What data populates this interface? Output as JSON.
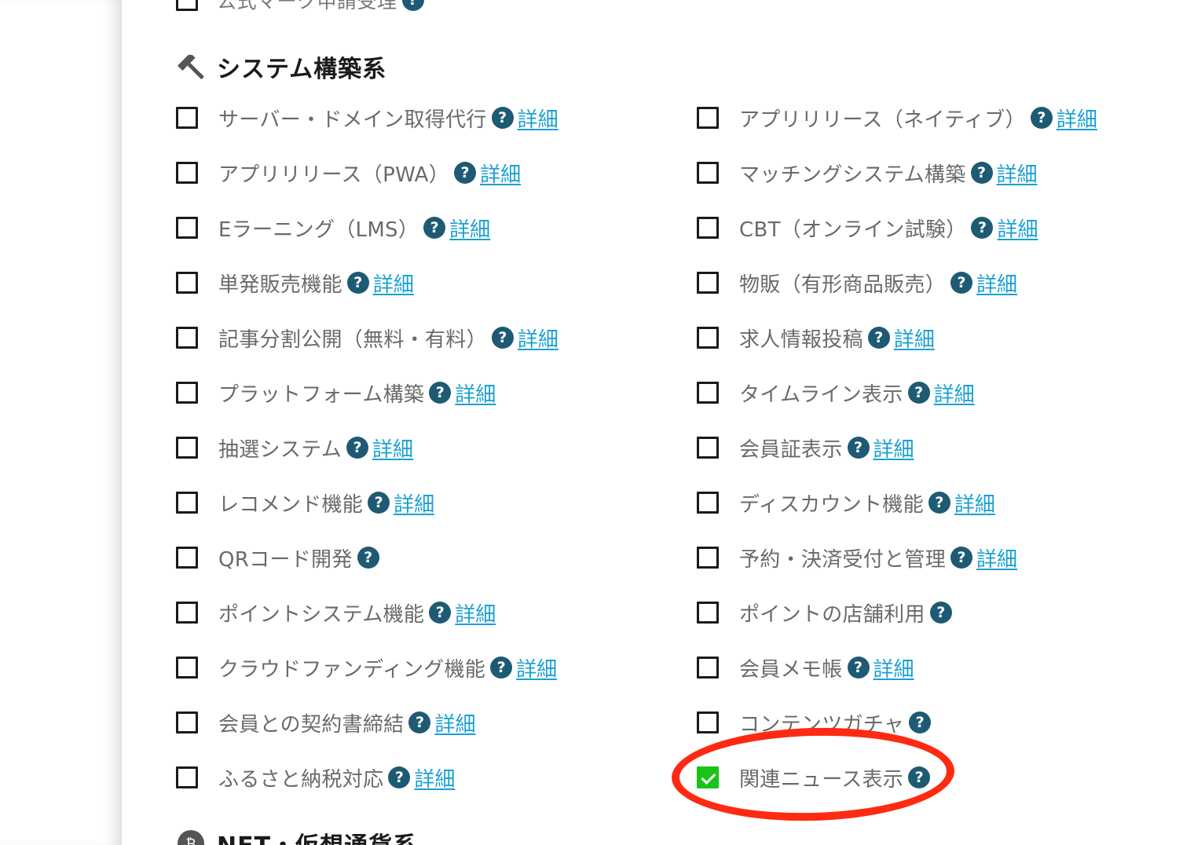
{
  "top_partial_item": {
    "label": "公式マーク申請受理"
  },
  "section_system": {
    "title": "システム構築系",
    "icon": "hammer-icon",
    "left_items": [
      {
        "label": "サーバー・ドメイン取得代行",
        "detail": "詳細",
        "checked": false
      },
      {
        "label": "アプリリリース（PWA）",
        "detail": "詳細",
        "checked": false
      },
      {
        "label": "Eラーニング（LMS）",
        "detail": "詳細",
        "checked": false
      },
      {
        "label": "単発販売機能",
        "detail": "詳細",
        "checked": false
      },
      {
        "label": "記事分割公開（無料・有料）",
        "detail": "詳細",
        "checked": false
      },
      {
        "label": "プラットフォーム構築",
        "detail": "詳細",
        "checked": false
      },
      {
        "label": "抽選システム",
        "detail": "詳細",
        "checked": false
      },
      {
        "label": "レコメンド機能",
        "detail": "詳細",
        "checked": false
      },
      {
        "label": "QRコード開発",
        "detail": "",
        "checked": false
      },
      {
        "label": "ポイントシステム機能",
        "detail": "詳細",
        "checked": false
      },
      {
        "label": "クラウドファンディング機能",
        "detail": "詳細",
        "checked": false
      },
      {
        "label": "会員との契約書締結",
        "detail": "詳細",
        "checked": false
      },
      {
        "label": "ふるさと納税対応",
        "detail": "詳細",
        "checked": false
      }
    ],
    "right_items": [
      {
        "label": "アプリリリース（ネイティブ）",
        "detail": "詳細",
        "checked": false
      },
      {
        "label": "マッチングシステム構築",
        "detail": "詳細",
        "checked": false
      },
      {
        "label": "CBT（オンライン試験）",
        "detail": "詳細",
        "checked": false
      },
      {
        "label": "物販（有形商品販売）",
        "detail": "詳細",
        "checked": false
      },
      {
        "label": "求人情報投稿",
        "detail": "詳細",
        "checked": false
      },
      {
        "label": "タイムライン表示",
        "detail": "詳細",
        "checked": false
      },
      {
        "label": "会員証表示",
        "detail": "詳細",
        "checked": false
      },
      {
        "label": "ディスカウント機能",
        "detail": "詳細",
        "checked": false
      },
      {
        "label": "予約・決済受付と管理",
        "detail": "詳細",
        "checked": false
      },
      {
        "label": "ポイントの店舗利用",
        "detail": "",
        "checked": false
      },
      {
        "label": "会員メモ帳",
        "detail": "詳細",
        "checked": false
      },
      {
        "label": "コンテンツガチャ",
        "detail": "",
        "checked": false
      },
      {
        "label": "関連ニュース表示",
        "detail": "",
        "checked": true
      }
    ]
  },
  "section_nft": {
    "title": "NFT・仮想通貨系",
    "icon": "coin-icon"
  },
  "help_glyph": "?",
  "colors": {
    "help_icon_bg": "#1e5a73",
    "link": "#1aa0d2",
    "checked_bg": "#18c418",
    "highlight": "#ff2a12"
  }
}
